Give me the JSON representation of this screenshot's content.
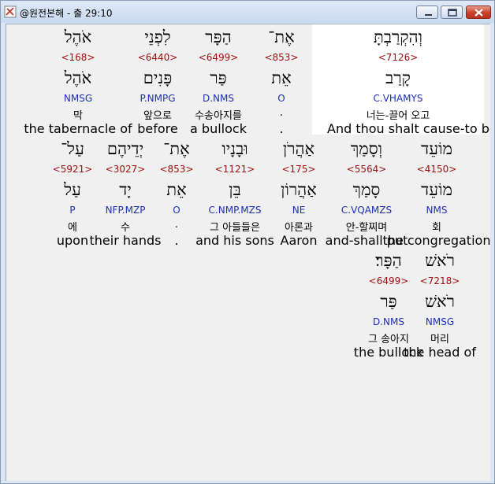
{
  "window": {
    "title": "@원전본해 - 출 29:10"
  },
  "words": [
    {
      "hebrew": "וְהִקְרַבְתָּ",
      "strong": "<7126>",
      "lemma": "קָרַב",
      "morph": "C.VHAMYS",
      "korean": "너는-끌어 오고",
      "english": "And thou shalt cause-to be brought"
    },
    {
      "hebrew": "אֶת־",
      "strong": "<853>",
      "lemma": "אֵת",
      "morph": "O",
      "korean": ".",
      "english": "."
    },
    {
      "hebrew": "הַפָּר",
      "strong": "<6499>",
      "lemma": "פַּר",
      "morph": "D.NMS",
      "korean": "수송아지를",
      "english": "a bullock"
    },
    {
      "hebrew": "לִפְנֵי",
      "strong": "<6440>",
      "lemma": "פָּנִים",
      "morph": "P.NMPG",
      "korean": "앞으로",
      "english": "before"
    },
    {
      "hebrew": "אֹהֶל",
      "strong": "<168>",
      "lemma": "אֹהֶל",
      "morph": "NMSG",
      "korean": "막",
      "english": "the tabernacle of"
    },
    {
      "hebrew": "מוֹעֵד",
      "strong": "<4150>",
      "lemma": "מוֹעֵד",
      "morph": "NMS",
      "korean": "회",
      "english": "the congregation"
    },
    {
      "hebrew": "וְסָמַךְ",
      "strong": "<5564>",
      "lemma": "סָמַךְ",
      "morph": "C.VQAMZS",
      "korean": "안-할찌며",
      "english": "and-shall put"
    },
    {
      "hebrew": "אַהֲרֹן",
      "strong": "<175>",
      "lemma": "אַהֲרוֹן",
      "morph": "NE",
      "korean": "아론과",
      "english": "Aaron"
    },
    {
      "hebrew": "וּבָנָיו",
      "strong": "<1121>",
      "lemma": "בֵּן",
      "morph": "C.NMP.MZS",
      "korean": "그 아들들은",
      "english": "and his sons"
    },
    {
      "hebrew": "אֶת־",
      "strong": "<853>",
      "lemma": "אֵת",
      "morph": "O",
      "korean": ".",
      "english": "."
    },
    {
      "hebrew": "יְדֵיהֶם",
      "strong": "<3027>",
      "lemma": "יָד",
      "morph": "NFP.MZP",
      "korean": "수",
      "english": "their hands"
    },
    {
      "hebrew": "עַל־",
      "strong": "<5921>",
      "lemma": "עַל",
      "morph": "P",
      "korean": "에",
      "english": "upon"
    },
    {
      "hebrew": "רֹאשׁ",
      "strong": "<7218>",
      "lemma": "רֹאשׁ",
      "morph": "NMSG",
      "korean": "머리",
      "english": "the head of"
    },
    {
      "hebrew": "הַפָּר׃",
      "strong": "<6499>",
      "lemma": "פַּר",
      "morph": "D.NMS",
      "korean": "그 송아지",
      "english": "the bullock"
    }
  ],
  "colors": {
    "strong": "#a01010",
    "morph": "#1c2fb3",
    "highlight": "#ffffff",
    "background": "#f0f0f0"
  }
}
